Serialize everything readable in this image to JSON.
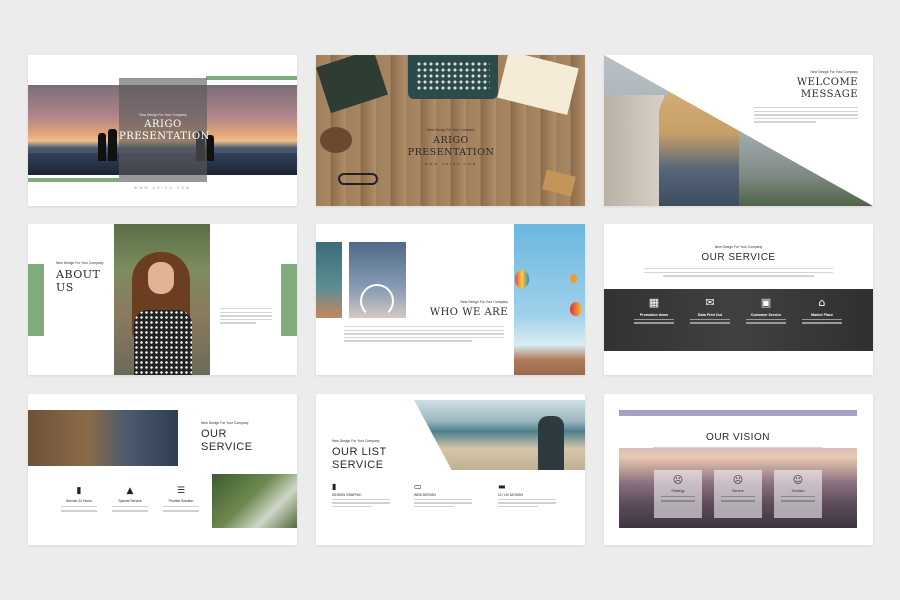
{
  "slides": {
    "s1": {
      "tag": "New Design For Your Company",
      "title_line1": "ARIGO",
      "title_line2": "PRESENTATION",
      "footer": "WWW.ARIGO.COM"
    },
    "s2": {
      "tag": "New Design For Your Company",
      "title_line1": "ARIGO",
      "title_line2": "PRESENTATION",
      "footer": "WWW.ARIGO.COM"
    },
    "s3": {
      "tag": "New Design For Your Company",
      "title_line1": "WELCOME",
      "title_line2": "MESSAGE"
    },
    "s4": {
      "tag": "New Design For Your Company",
      "title_line1": "ABOUT",
      "title_line2": "US"
    },
    "s5": {
      "tag": "New Design For Your Company",
      "title": "WHO WE ARE"
    },
    "s6": {
      "tag": "New Design For Your Company",
      "title": "OUR SERVICE",
      "services": [
        {
          "icon": "▦",
          "label": "Promotion Items"
        },
        {
          "icon": "✉",
          "label": "Data Print Out"
        },
        {
          "icon": "▣",
          "label": "Customer Service"
        },
        {
          "icon": "⌂",
          "label": "Market Place"
        }
      ]
    },
    "s7": {
      "tag": "New Design For Your Company",
      "title_line1": "OUR",
      "title_line2": "SERVICE",
      "items": [
        {
          "icon": "▮",
          "label": "Service 24 Hours"
        },
        {
          "icon": "▲",
          "label": "Special Service"
        },
        {
          "icon": "☰",
          "label": "Provide Solution"
        }
      ]
    },
    "s8": {
      "tag": "New Design For Your Company",
      "title_line1": "OUR LIST",
      "title_line2": "SERVICE",
      "items": [
        {
          "icon": "▮",
          "label": "DESIGN GRAPHIC"
        },
        {
          "icon": "▭",
          "label": "WEB DESIGN"
        },
        {
          "icon": "▬",
          "label": "UI / UX DESIGN"
        }
      ]
    },
    "s9": {
      "title": "OUR VISION",
      "cards": [
        {
          "icon": "☹",
          "label": "Strategy"
        },
        {
          "icon": "☹",
          "label": "Service"
        },
        {
          "icon": "☺",
          "label": "Solution"
        }
      ]
    }
  },
  "colors": {
    "accent_green": "#7fab7d",
    "background": "#ececec"
  }
}
